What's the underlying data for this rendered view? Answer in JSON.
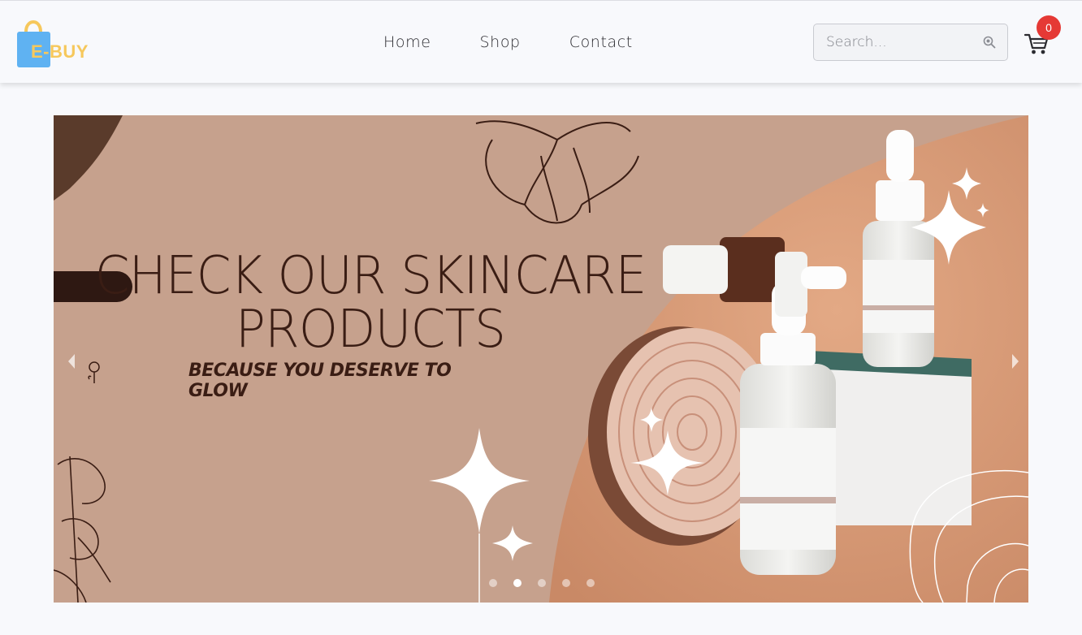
{
  "brand": {
    "name": "E-BUY"
  },
  "nav": {
    "items": [
      {
        "label": "Home"
      },
      {
        "label": "Shop"
      },
      {
        "label": "Contact"
      }
    ]
  },
  "search": {
    "placeholder": "Search...",
    "value": ""
  },
  "cart": {
    "count": "0"
  },
  "hero": {
    "headline_line1": "CHECK OUR SKINCARE",
    "headline_line2": "PRODUCTS",
    "tagline": "BECAUSE YOU DESERVE TO GLOW",
    "slides_count": 5,
    "active_slide": 2
  },
  "colors": {
    "accent_yellow": "#f6c85c",
    "bag_blue": "#5fb2f2",
    "hero_bg": "#c6a18d",
    "headline": "#3a1d14",
    "badge_red": "#e53935"
  }
}
